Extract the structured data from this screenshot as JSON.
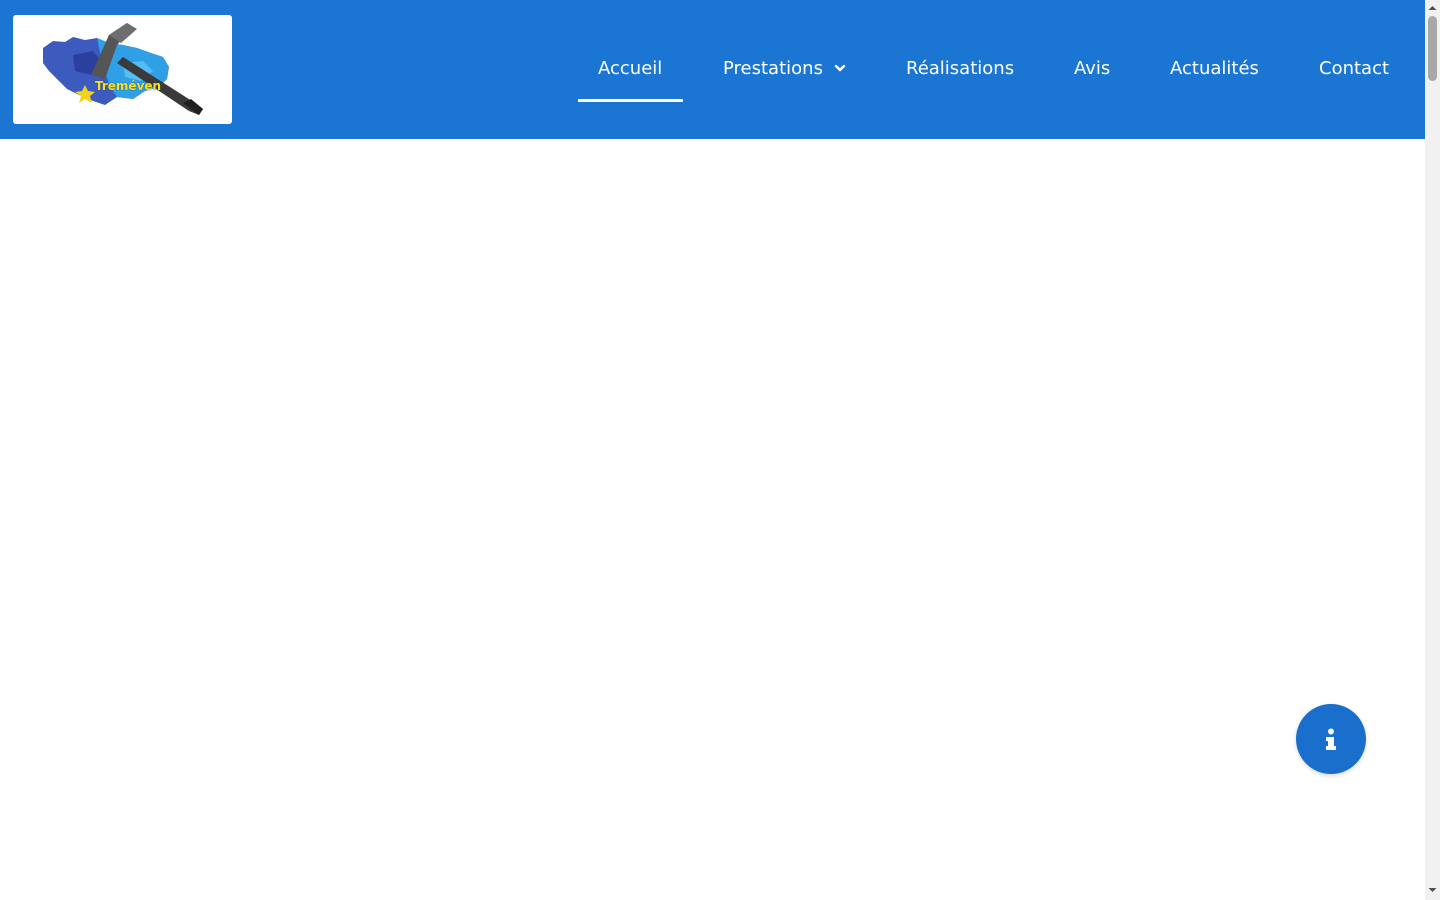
{
  "header": {
    "brand_color": "#1b76d3",
    "logo": {
      "wordmark": "Treméven",
      "icon": "hammer-map-logo"
    }
  },
  "nav": {
    "items": [
      {
        "label": "Accueil",
        "active": true
      },
      {
        "label": "Prestations",
        "has_dropdown": true,
        "icon": "chevron-down-icon"
      },
      {
        "label": "Réalisations"
      },
      {
        "label": "Avis"
      },
      {
        "label": "Actualités"
      },
      {
        "label": "Contact"
      }
    ]
  },
  "floating_button": {
    "icon": "info-icon",
    "color": "#1b6fcc"
  }
}
